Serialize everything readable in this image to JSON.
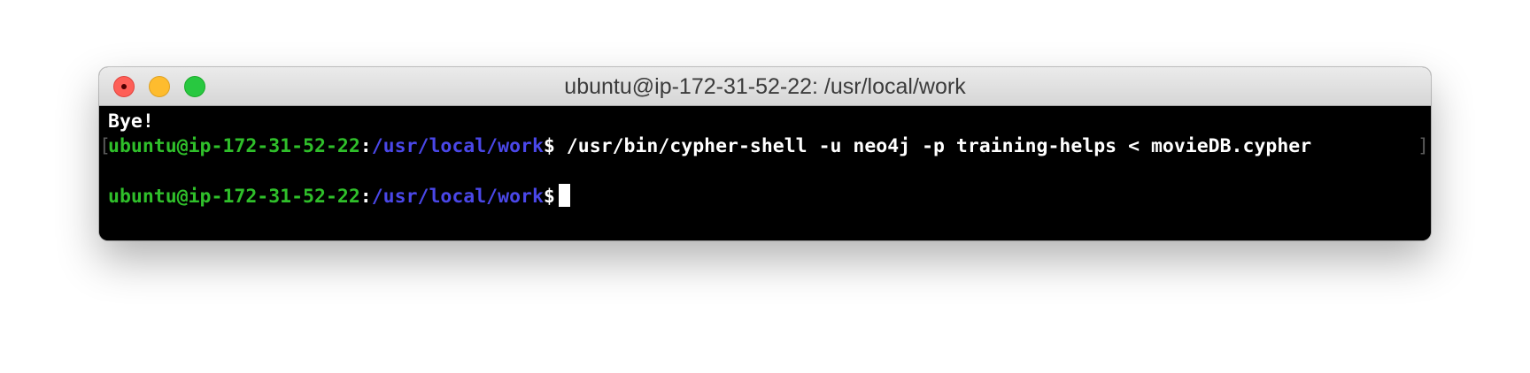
{
  "window": {
    "title": "ubuntu@ip-172-31-52-22: /usr/local/work"
  },
  "terminal": {
    "line1": "Bye!",
    "prompt": {
      "user_host": "ubuntu@ip-172-31-52-22",
      "colon": ":",
      "path": "/usr/local/work",
      "dollar": "$"
    },
    "command": " /usr/bin/cypher-shell -u neo4j -p training-helps < movieDB.cypher ",
    "bracket_left": "[",
    "bracket_right": "]"
  },
  "colors": {
    "prompt_user": "#2fbf2a",
    "prompt_path": "#4a47e8",
    "background": "#000000",
    "text": "#ffffff"
  }
}
